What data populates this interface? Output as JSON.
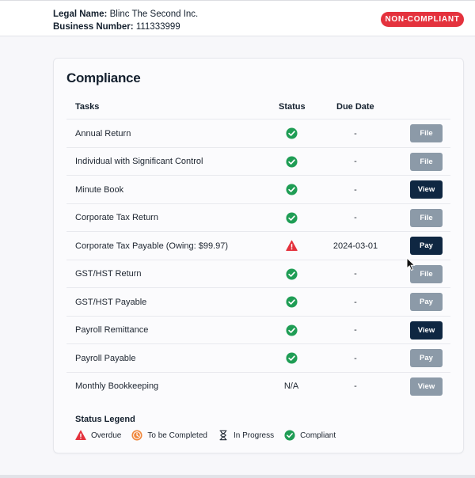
{
  "header": {
    "legal_name_label": "Legal Name:",
    "legal_name": "Blinc The Second Inc.",
    "business_number_label": "Business Number:",
    "business_number": "111333999",
    "status_badge": "NON-COMPLIANT"
  },
  "compliance": {
    "title": "Compliance",
    "columns": {
      "tasks": "Tasks",
      "status": "Status",
      "due_date": "Due Date"
    },
    "rows": [
      {
        "task": "Annual Return",
        "status": "compliant",
        "due": "-",
        "action": "File",
        "action_style": "muted"
      },
      {
        "task": "Individual with Significant Control",
        "status": "compliant",
        "due": "-",
        "action": "File",
        "action_style": "muted"
      },
      {
        "task": "Minute Book",
        "status": "compliant",
        "due": "-",
        "action": "View",
        "action_style": "dark"
      },
      {
        "task": "Corporate Tax Return",
        "status": "compliant",
        "due": "-",
        "action": "File",
        "action_style": "muted"
      },
      {
        "task": "Corporate Tax Payable (Owing: $99.97)",
        "status": "overdue",
        "due": "2024-03-01",
        "action": "Pay",
        "action_style": "dark"
      },
      {
        "task": "GST/HST Return",
        "status": "compliant",
        "due": "-",
        "action": "File",
        "action_style": "muted"
      },
      {
        "task": "GST/HST Payable",
        "status": "compliant",
        "due": "-",
        "action": "Pay",
        "action_style": "muted"
      },
      {
        "task": "Payroll Remittance",
        "status": "compliant",
        "due": "-",
        "action": "View",
        "action_style": "dark"
      },
      {
        "task": "Payroll Payable",
        "status": "compliant",
        "due": "-",
        "action": "Pay",
        "action_style": "muted"
      },
      {
        "task": "Monthly Bookkeeping",
        "status": "na",
        "status_text": "N/A",
        "due": "-",
        "action": "View",
        "action_style": "muted"
      }
    ],
    "legend": {
      "title": "Status Legend",
      "items": [
        {
          "key": "overdue",
          "label": "Overdue",
          "icon": "warning-triangle-icon"
        },
        {
          "key": "to_be_completed",
          "label": "To be Completed",
          "icon": "clock-icon"
        },
        {
          "key": "in_progress",
          "label": "In Progress",
          "icon": "hourglass-icon"
        },
        {
          "key": "compliant",
          "label": "Compliant",
          "icon": "check-circle-icon"
        }
      ]
    }
  },
  "colors": {
    "compliant": "#1f9d55",
    "overdue": "#e4323d",
    "to_be_completed": "#f0883e",
    "in_progress": "#1d2530",
    "button_dark": "#0f2742",
    "button_muted": "#8c9aa8",
    "badge": "#e4323d"
  }
}
